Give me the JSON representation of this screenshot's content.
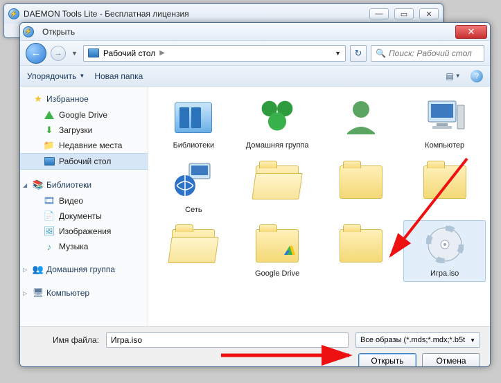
{
  "parent_window": {
    "title": "DAEMON Tools Lite - Бесплатная лицензия"
  },
  "dialog": {
    "title": "Открыть",
    "address": {
      "location": "Рабочий стол",
      "search_placeholder": "Поиск: Рабочий стол"
    },
    "toolbar": {
      "organize": "Упорядочить",
      "new_folder": "Новая папка"
    },
    "sidebar": {
      "favorites": {
        "label": "Избранное",
        "items": [
          {
            "label": "Google Drive",
            "icon": "gdrive"
          },
          {
            "label": "Загрузки",
            "icon": "downloads"
          },
          {
            "label": "Недавние места",
            "icon": "recent"
          },
          {
            "label": "Рабочий стол",
            "icon": "desktop",
            "selected": true
          }
        ]
      },
      "libraries": {
        "label": "Библиотеки",
        "items": [
          {
            "label": "Видео",
            "icon": "video"
          },
          {
            "label": "Документы",
            "icon": "documents"
          },
          {
            "label": "Изображения",
            "icon": "images"
          },
          {
            "label": "Музыка",
            "icon": "music"
          }
        ]
      },
      "homegroup": {
        "label": "Домашняя группа"
      },
      "computer": {
        "label": "Компьютер"
      }
    },
    "files": [
      {
        "label": "Библиотеки",
        "icon": "libraries"
      },
      {
        "label": "Домашняя группа",
        "icon": "homegroup"
      },
      {
        "label": "",
        "icon": "user"
      },
      {
        "label": "Компьютер",
        "icon": "computer"
      },
      {
        "label": "Сеть",
        "icon": "network"
      },
      {
        "label": "",
        "icon": "folder-open"
      },
      {
        "label": "",
        "icon": "folder"
      },
      {
        "label": "",
        "icon": "folder"
      },
      {
        "label": "",
        "icon": "folder-open"
      },
      {
        "label": "Google Drive",
        "icon": "folder-gdrive"
      },
      {
        "label": "",
        "icon": "folder"
      },
      {
        "label": "Игра.iso",
        "icon": "disc",
        "selected": true
      }
    ],
    "footer": {
      "filename_label": "Имя файла:",
      "filename_value": "Игра.iso",
      "filter": "Все образы (*.mds;*.mdx;*.b5t",
      "open": "Открыть",
      "cancel": "Отмена"
    }
  }
}
